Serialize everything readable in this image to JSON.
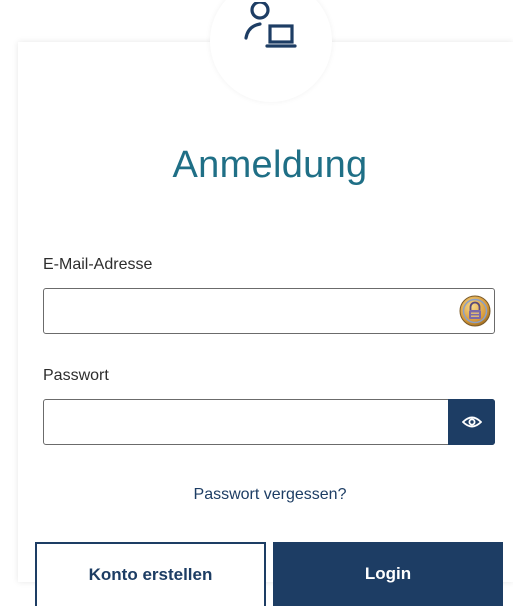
{
  "title": "Anmeldung",
  "email": {
    "label": "E-Mail-Adresse",
    "value": "",
    "placeholder": ""
  },
  "password": {
    "label": "Passwort",
    "value": "",
    "placeholder": ""
  },
  "forgot_link": "Passwort vergessen?",
  "buttons": {
    "create_account": "Konto erstellen",
    "login": "Login"
  },
  "icons": {
    "avatar": "user-laptop-icon",
    "password_manager": "padlock-badge-icon",
    "show_password": "eye-icon"
  },
  "colors": {
    "accent_teal": "#1f6f86",
    "primary_navy": "#1d3d64",
    "badge_gold": "#d79a3a"
  }
}
